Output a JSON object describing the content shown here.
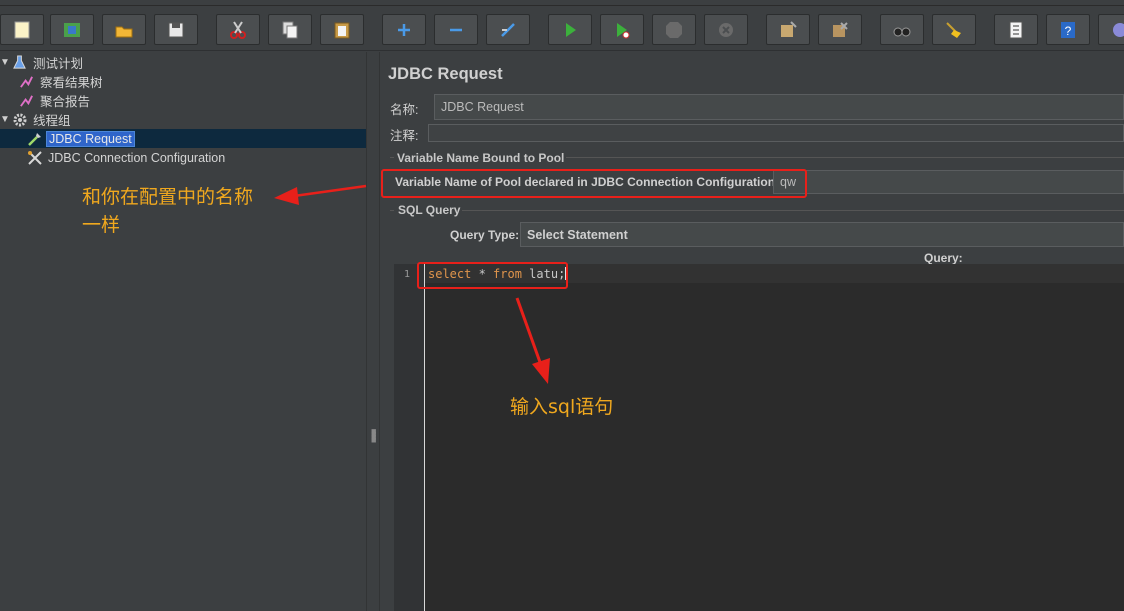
{
  "toolbar": {
    "buttons": [
      {
        "icon": "new-icon"
      },
      {
        "icon": "templates-icon"
      },
      {
        "icon": "open-icon"
      },
      {
        "icon": "save-icon"
      },
      {
        "icon": "cut-icon"
      },
      {
        "icon": "copy-icon"
      },
      {
        "icon": "paste-icon"
      },
      {
        "icon": "expand-icon"
      },
      {
        "icon": "collapse-icon"
      },
      {
        "icon": "toggle-icon"
      },
      {
        "icon": "start-icon"
      },
      {
        "icon": "start-no-pauses-icon"
      },
      {
        "icon": "stop-icon"
      },
      {
        "icon": "shutdown-icon"
      },
      {
        "icon": "remote-start-icon"
      },
      {
        "icon": "remote-stop-icon"
      },
      {
        "icon": "search-icon"
      },
      {
        "icon": "clear-icon"
      },
      {
        "icon": "function-helper-icon"
      },
      {
        "icon": "help-icon"
      },
      {
        "icon": "more-icon"
      }
    ]
  },
  "tree": {
    "test_plan": "测试计划",
    "view_results_tree": "察看结果树",
    "aggregate_report": "聚合报告",
    "thread_group": "线程组",
    "jdbc_request": "JDBC Request",
    "jdbc_connection_config": "JDBC Connection Configuration"
  },
  "panel": {
    "title": "JDBC Request",
    "name_label": "名称:",
    "name_value": "JDBC Request",
    "comments_label": "注释:",
    "comments_value": "",
    "pool_group_title": "Variable Name Bound to Pool",
    "pool_label": "Variable Name of Pool declared in JDBC Connection Configuration:",
    "pool_value": "qw",
    "sql_group_title": "SQL Query",
    "query_type_label": "Query Type:",
    "query_type_value": "Select Statement",
    "query_label": "Query:",
    "line_number": "1",
    "sql": {
      "kw1": "select",
      "mid": " * ",
      "kw2": "from",
      "rest": " latu;"
    }
  },
  "annotations": {
    "pool_note": "和你在配置中的名称\n一样",
    "sql_note": "输入sql语句"
  },
  "colors": {
    "annotation": "#f0a81e",
    "highlight_box": "#e8201a",
    "selection": "#2f65ca"
  }
}
